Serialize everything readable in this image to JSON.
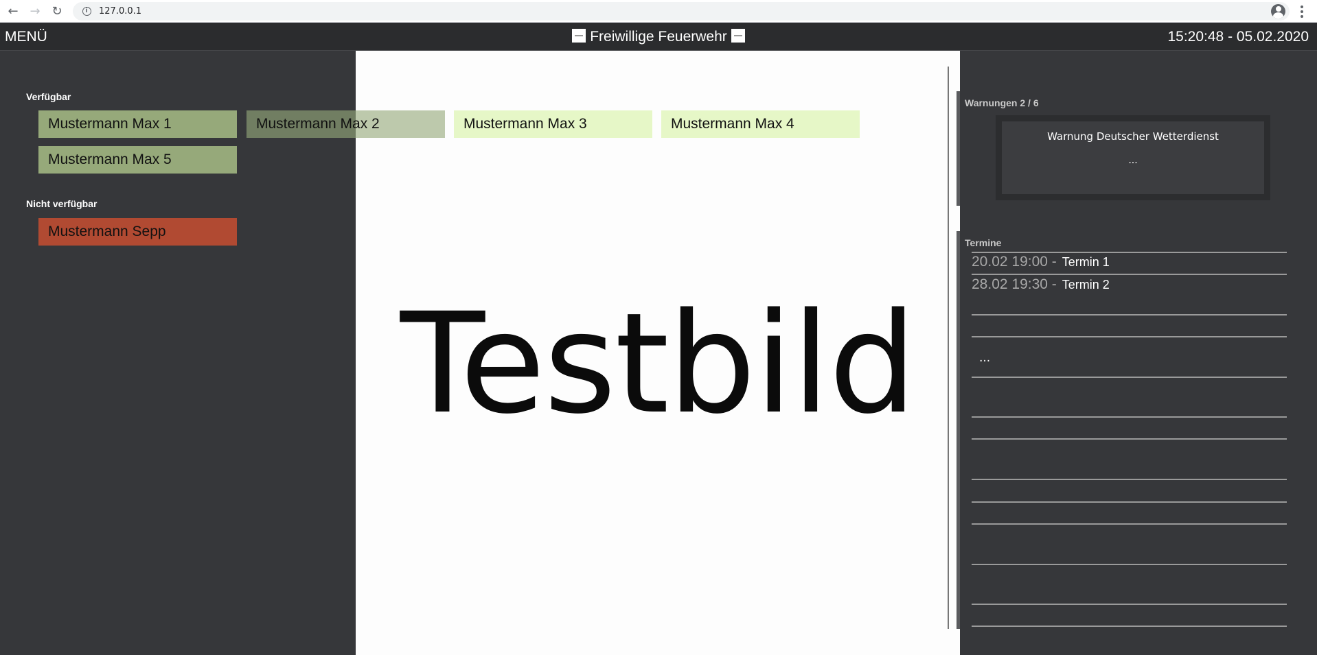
{
  "browser": {
    "url": "127.0.0.1"
  },
  "header": {
    "menu_label": "MENÜ",
    "title": "Freiwillige Feuerwehr",
    "datetime": "15:20:48 - 05.02.2020"
  },
  "personnel": {
    "available_label": "Verfügbar",
    "available": [
      {
        "name": "Mustermann Max 1"
      },
      {
        "name": "Mustermann Max 2"
      },
      {
        "name": "Mustermann Max 3"
      },
      {
        "name": "Mustermann Max 4"
      },
      {
        "name": "Mustermann Max 5"
      }
    ],
    "unavailable_label": "Nicht verfügbar",
    "unavailable": [
      {
        "name": "Mustermann Sepp"
      }
    ]
  },
  "center": {
    "image_text": "Testbild"
  },
  "warnings": {
    "label": "Warnungen 2 / 6",
    "title": "Warnung Deutscher Wetterdienst",
    "more": "..."
  },
  "appointments": {
    "label": "Termine",
    "items": [
      {
        "time": "20.02 19:00 -",
        "name": "Termin 1"
      },
      {
        "time": "28.02 19:30 -",
        "name": "Termin 2"
      }
    ],
    "more": "..."
  },
  "colors": {
    "available": "#96a97a",
    "pale": "#e6f7c7",
    "unavailable": "#b14a32",
    "background": "#36373a"
  }
}
